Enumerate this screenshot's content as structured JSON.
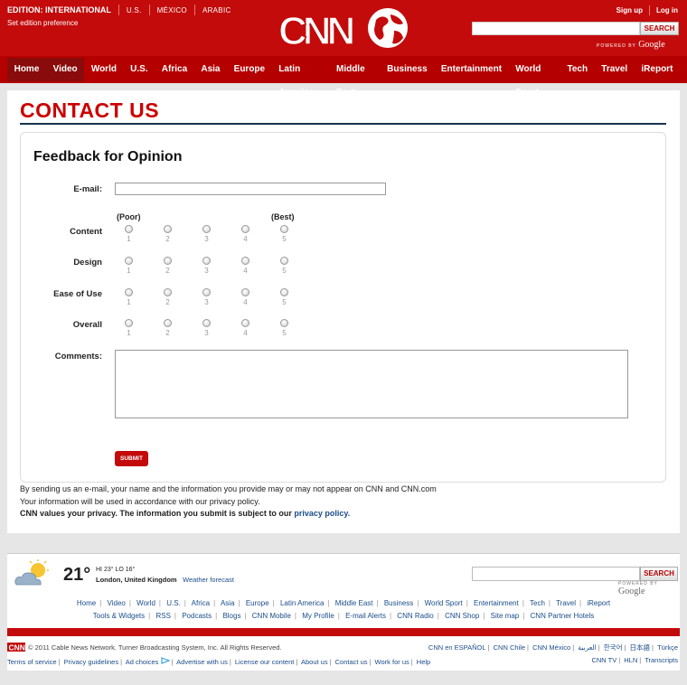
{
  "header": {
    "edition_label": "EDITION: INTERNATIONAL",
    "edition_options": [
      "U.S.",
      "MÉXICO",
      "ARABIC"
    ],
    "set_edition": "Set edition preference",
    "logo_text": "CNN",
    "sign_up": "Sign up",
    "log_in": "Log in",
    "search_button": "SEARCH",
    "powered_prefix": "POWERED BY",
    "powered_brand": "Google",
    "brand_color": "#c30b0b"
  },
  "nav": [
    "Home",
    "Video",
    "World",
    "U.S.",
    "Africa",
    "Asia",
    "Europe",
    "Latin America",
    "Middle East",
    "Business",
    "Entertainment",
    "World Sport",
    "Tech",
    "Travel",
    "iReport"
  ],
  "page": {
    "title": "CONTACT US",
    "form_title": "Feedback for Opinion",
    "email_label": "E-mail:",
    "poor": "(Poor)",
    "best": "(Best)",
    "ratings": [
      "Content",
      "Design",
      "Ease of Use",
      "Overall"
    ],
    "scale": [
      "1",
      "2",
      "3",
      "4",
      "5"
    ],
    "comments_label": "Comments:",
    "submit": "SUBMIT",
    "disclaimer1": "By sending us an e-mail, your name and the information you provide may or may not appear on CNN and CNN.com",
    "disclaimer2": "Your information will be used in accordance with our privacy policy.",
    "disclaimer3": "CNN values your privacy. The information you submit is subject to our",
    "privacy_link": "privacy policy."
  },
  "footer": {
    "temp": "21°",
    "hilo": "HI 23°  LO 16°",
    "location": "London, United Kingdom",
    "weather_link": "Weather forecast",
    "search_button": "SEARCH",
    "powered_prefix": "POWERED BY",
    "powered_brand": "Google",
    "links1": [
      "Home",
      "Video",
      "World",
      "U.S.",
      "Africa",
      "Asia",
      "Europe",
      "Latin America",
      "Middle East",
      "Business",
      "World Sport",
      "Entertainment",
      "Tech",
      "Travel",
      "iReport"
    ],
    "links2": [
      "Tools & Widgets",
      "RSS",
      "Podcasts",
      "Blogs",
      "CNN Mobile",
      "My Profile",
      "E-mail Alerts",
      "CNN Radio",
      "CNN Shop",
      "Site map",
      "CNN Partner Hotels"
    ],
    "copyright": "© 2011 Cable News Network. Turner Broadcasting System, Inc. All Rights Reserved.",
    "intl": [
      "CNN en ESPAÑOL",
      "CNN Chile",
      "CNN México",
      "العربية",
      "한국어",
      "日本語",
      "Türkçe"
    ],
    "legal": [
      "Terms of service",
      "Privacy guidelines",
      "Ad choices",
      "Advertise with us",
      "License our content",
      "About us",
      "Contact us",
      "Work for us",
      "Help"
    ],
    "legal2": [
      "CNN TV",
      "HLN",
      "Transcripts"
    ]
  }
}
